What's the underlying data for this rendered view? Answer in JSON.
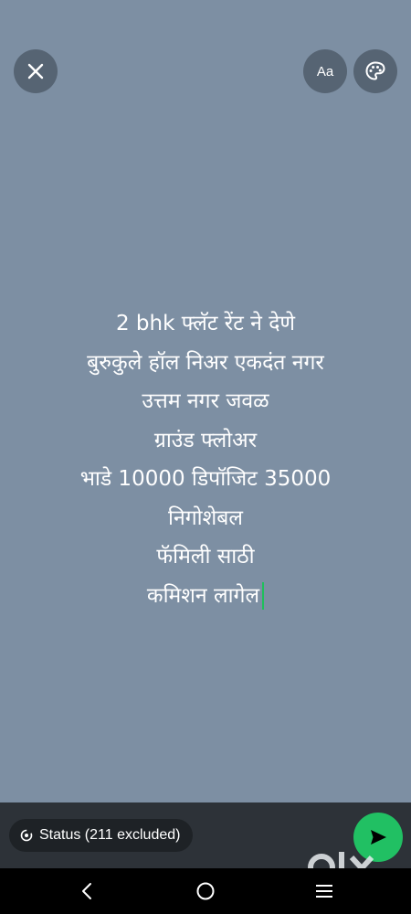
{
  "top_bar": {
    "close_icon": "close-icon",
    "font_button_label": "Aa",
    "color_icon": "palette-icon"
  },
  "editor": {
    "lines": [
      "2 bhk फ्लॅट रेंट ने देणे",
      "बुरुकुले हॉल निअर एकदंत नगर",
      "उत्तम नगर जवळ",
      "ग्राउंड फ्लोअर",
      "भाडे 10000 डिपॉजिट 35000",
      "निगोशेबल",
      "फॅमिली साठी",
      "कमिशन लागेल"
    ],
    "cursor_color": "#1fbf5c"
  },
  "bottom_bar": {
    "status_chip_label": "Status (211 excluded)",
    "send_icon": "send-icon",
    "send_color": "#21c063"
  },
  "watermark": {
    "text": "OLX"
  },
  "colors": {
    "background": "#7d8fa3",
    "bottom_bar": "#2d3238",
    "nav_bar": "#000000"
  },
  "nav_bar": {
    "items": [
      "back-icon",
      "home-icon",
      "recents-icon"
    ]
  }
}
